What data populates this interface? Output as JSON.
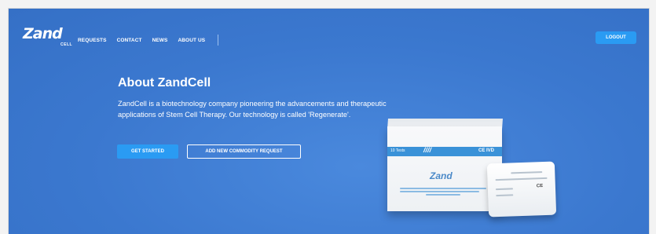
{
  "brand": {
    "logo_text": "Zand",
    "logo_sub": "CELL"
  },
  "nav": {
    "links": [
      "REQUESTS",
      "CONTACT",
      "NEWS",
      "ABOUT US"
    ],
    "logout_label": "LOGOUT"
  },
  "hero": {
    "title": "About ZandCell",
    "description": "ZandCell is a biotechnology company pioneering the advancements and therapeutic applications of Stem Cell Therapy. Our technology is called 'Regenerate'.",
    "primary_button": "GET STARTED",
    "secondary_button": "ADD NEW COMMODITY REQUEST"
  },
  "product": {
    "tests_label": "10 Tests",
    "ce_mark": "CE IVD",
    "box_logo": "Zand"
  },
  "colors": {
    "hero_bg": "#3d7bd2",
    "button_blue": "#2a9bf3",
    "text": "#ffffff"
  }
}
